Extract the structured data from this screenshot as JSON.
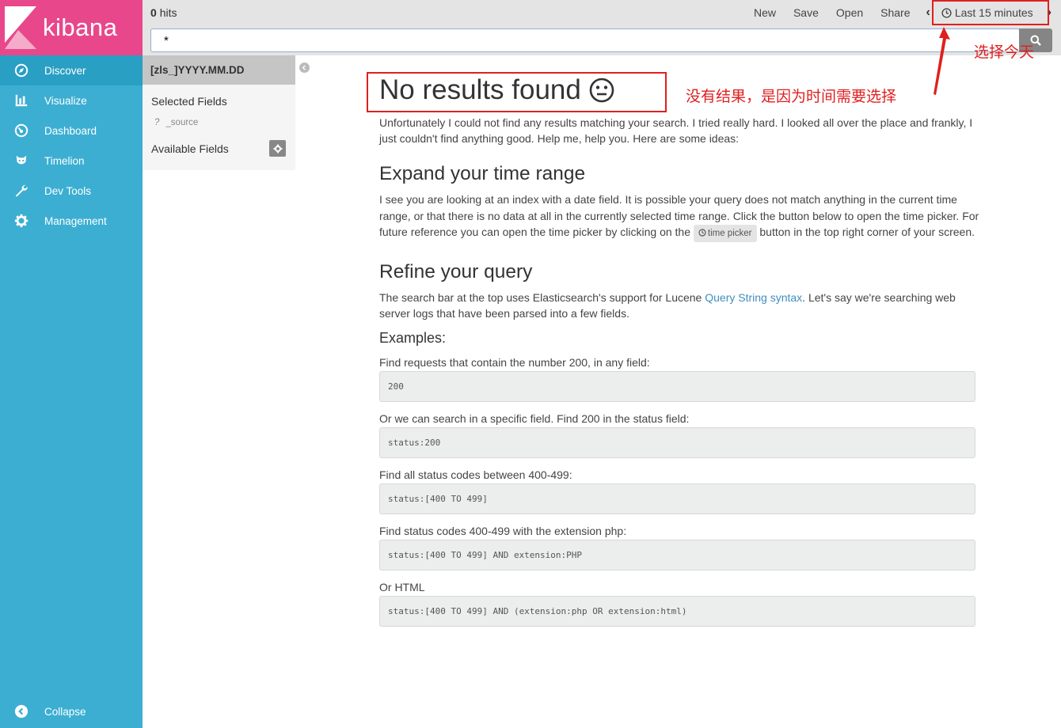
{
  "app": {
    "name": "kibana"
  },
  "sidebar": {
    "items": [
      {
        "label": "Discover",
        "icon": "compass-icon"
      },
      {
        "label": "Visualize",
        "icon": "bar-chart-icon"
      },
      {
        "label": "Dashboard",
        "icon": "dashboard-icon"
      },
      {
        "label": "Timelion",
        "icon": "timelion-icon"
      },
      {
        "label": "Dev Tools",
        "icon": "wrench-icon"
      },
      {
        "label": "Management",
        "icon": "gear-icon"
      }
    ],
    "collapse_label": "Collapse"
  },
  "topbar": {
    "hits_count": "0",
    "hits_label": "hits",
    "menu": {
      "new": "New",
      "save": "Save",
      "open": "Open",
      "share": "Share"
    },
    "time_range": "Last 15 minutes",
    "query": "*"
  },
  "fields_panel": {
    "index_pattern": "[zls_]YYYY.MM.DD",
    "selected_fields_label": "Selected Fields",
    "source_field": "_source",
    "source_type": "?",
    "available_fields_label": "Available Fields"
  },
  "main": {
    "title": "No results found",
    "intro": "Unfortunately I could not find any results matching your search. I tried really hard. I looked all over the place and frankly, I just couldn't find anything good. Help me, help you. Here are some ideas:",
    "expand_heading": "Expand your time range",
    "expand_text_1": "I see you are looking at an index with a date field. It is possible your query does not match anything in the current time range, or that there is no data at all in the currently selected time range. Click the button below to open the time picker. For future reference you can open the time picker by clicking on the",
    "time_picker_label": "time picker",
    "expand_text_2": "button in the top right corner of your screen.",
    "refine_heading": "Refine your query",
    "refine_text_1": "The search bar at the top uses Elasticsearch's support for Lucene",
    "refine_link": "Query String syntax",
    "refine_text_2": ". Let's say we're searching web server logs that have been parsed into a few fields.",
    "examples_heading": "Examples:",
    "examples": [
      {
        "label": "Find requests that contain the number 200, in any field:",
        "code": "200"
      },
      {
        "label": "Or we can search in a specific field. Find 200 in the status field:",
        "code": "status:200"
      },
      {
        "label": "Find all status codes between 400-499:",
        "code": "status:[400 TO 499]"
      },
      {
        "label": "Find status codes 400-499 with the extension php:",
        "code": "status:[400 TO 499] AND extension:PHP"
      },
      {
        "label": "Or HTML",
        "code": "status:[400 TO 499] AND (extension:php OR extension:html)"
      }
    ]
  },
  "annotations": {
    "note_main": "没有结果，是因为时间需要选择",
    "note_time": "选择今天",
    "color": "#e01f1f"
  }
}
